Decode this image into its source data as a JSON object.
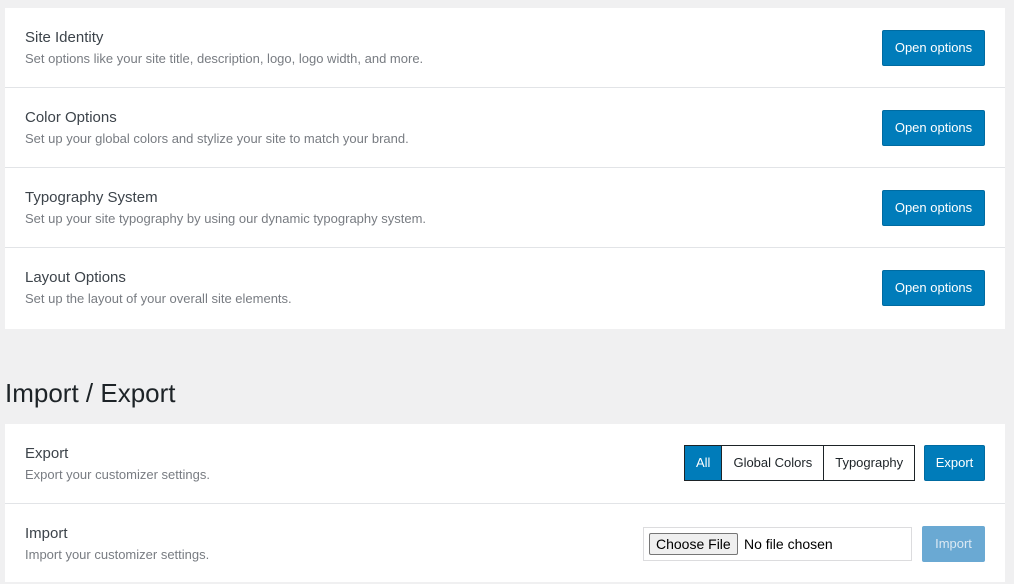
{
  "options_panel": {
    "rows": [
      {
        "title": "Site Identity",
        "description": "Set options like your site title, description, logo, logo width, and more.",
        "button_label": "Open options"
      },
      {
        "title": "Color Options",
        "description": "Set up your global colors and stylize your site to match your brand.",
        "button_label": "Open options"
      },
      {
        "title": "Typography System",
        "description": "Set up your site typography by using our dynamic typography system.",
        "button_label": "Open options"
      },
      {
        "title": "Layout Options",
        "description": "Set up the layout of your overall site elements.",
        "button_label": "Open options"
      }
    ]
  },
  "import_export": {
    "heading": "Import / Export",
    "export": {
      "title": "Export",
      "description": "Export your customizer settings.",
      "filter_options": [
        "All",
        "Global Colors",
        "Typography"
      ],
      "selected_filter": "All",
      "button_label": "Export"
    },
    "import": {
      "title": "Import",
      "description": "Import your customizer settings.",
      "file_button_label": "Choose File",
      "file_status": "No file chosen",
      "button_label": "Import"
    }
  },
  "colors": {
    "accent": "#007cba",
    "background": "#f0f0f1",
    "card": "#ffffff",
    "disabled_button": "#6aa9d3"
  }
}
